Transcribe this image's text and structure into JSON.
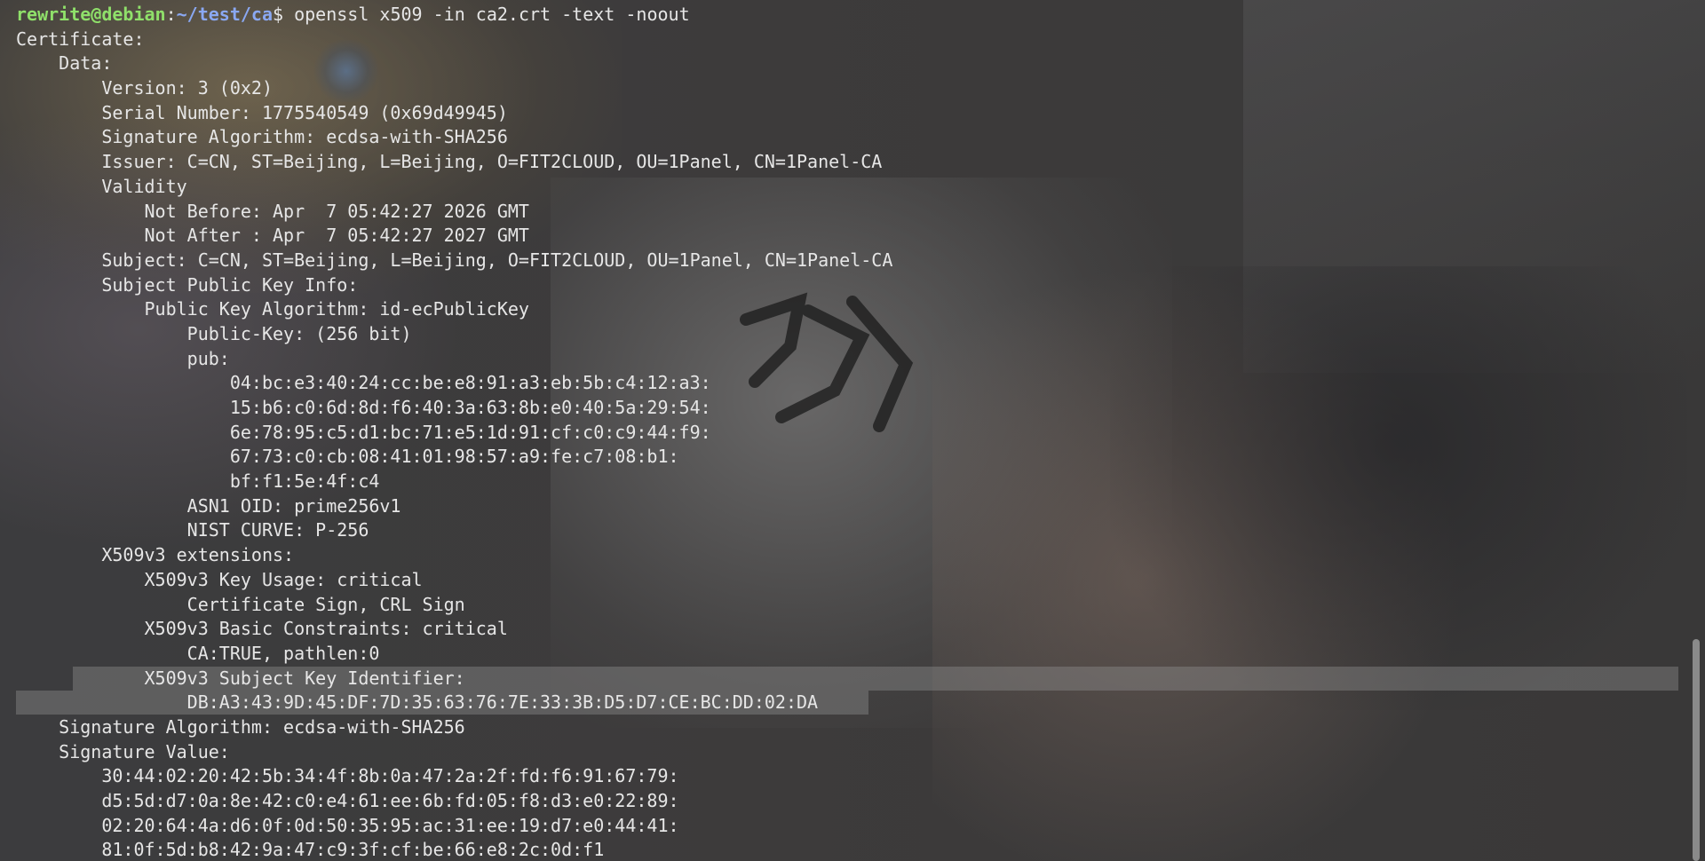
{
  "terminal": {
    "prompt": {
      "user_host": "rewrite@debian",
      "separator": ":",
      "path": "~/test/ca",
      "symbol": "$",
      "command": " openssl x509 -in ca2.crt -text -noout"
    },
    "output_lines": [
      "Certificate:",
      "    Data:",
      "        Version: 3 (0x2)",
      "        Serial Number: 1775540549 (0x69d49945)",
      "        Signature Algorithm: ecdsa-with-SHA256",
      "        Issuer: C=CN, ST=Beijing, L=Beijing, O=FIT2CLOUD, OU=1Panel, CN=1Panel-CA",
      "        Validity",
      "            Not Before: Apr  7 05:42:27 2026 GMT",
      "            Not After : Apr  7 05:42:27 2027 GMT",
      "        Subject: C=CN, ST=Beijing, L=Beijing, O=FIT2CLOUD, OU=1Panel, CN=1Panel-CA",
      "        Subject Public Key Info:",
      "            Public Key Algorithm: id-ecPublicKey",
      "                Public-Key: (256 bit)",
      "                pub:",
      "                    04:bc:e3:40:24:cc:be:e8:91:a3:eb:5b:c4:12:a3:",
      "                    15:b6:c0:6d:8d:f6:40:3a:63:8b:e0:40:5a:29:54:",
      "                    6e:78:95:c5:d1:bc:71:e5:1d:91:cf:c0:c9:44:f9:",
      "                    67:73:c0:cb:08:41:01:98:57:a9:fe:c7:08:b1:",
      "                    bf:f1:5e:4f:c4",
      "                ASN1 OID: prime256v1",
      "                NIST CURVE: P-256",
      "        X509v3 extensions:",
      "            X509v3 Key Usage: critical",
      "                Certificate Sign, CRL Sign",
      "            X509v3 Basic Constraints: critical",
      "                CA:TRUE, pathlen:0",
      "            X509v3 Subject Key Identifier:",
      "                DB:A3:43:9D:45:DF:7D:35:63:76:7E:33:3B:D5:D7:CE:BC:DD:02:DA",
      "    Signature Algorithm: ecdsa-with-SHA256",
      "    Signature Value:",
      "        30:44:02:20:42:5b:34:4f:8b:0a:47:2a:2f:fd:f6:91:67:79:",
      "        d5:5d:d7:0a:8e:42:c0:e4:61:ee:6b:fd:05:f8:d3:e0:22:89:",
      "        02:20:64:4a:d6:0f:0d:50:35:95:ac:31:ee:19:d7:e0:44:41:",
      "        81:0f:5d:b8:42:9a:47:c9:3f:cf:be:66:e8:2c:0d:f1"
    ]
  },
  "colors": {
    "text": "#e6e6e6",
    "prompt_user": "#8fe06a",
    "prompt_path": "#8aa8f2",
    "selection": "rgba(150,150,150,0.38)"
  }
}
